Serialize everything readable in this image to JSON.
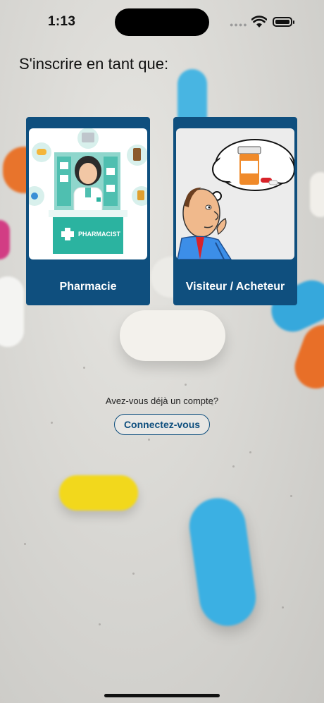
{
  "status_bar": {
    "time": "1:13"
  },
  "heading": "S'inscrire en tant que:",
  "cards": [
    {
      "label": "Pharmacie",
      "image_text": "PHARMACIST",
      "icon": "pharmacist-illustration"
    },
    {
      "label": "Visiteur / Acheteur",
      "icon": "thinking-buyer-illustration"
    }
  ],
  "login": {
    "question": "Avez-vous déjà un compte?",
    "button_label": "Connectez-vous"
  },
  "colors": {
    "primary": "#0f4f7e",
    "teal": "#2bb3a0"
  }
}
